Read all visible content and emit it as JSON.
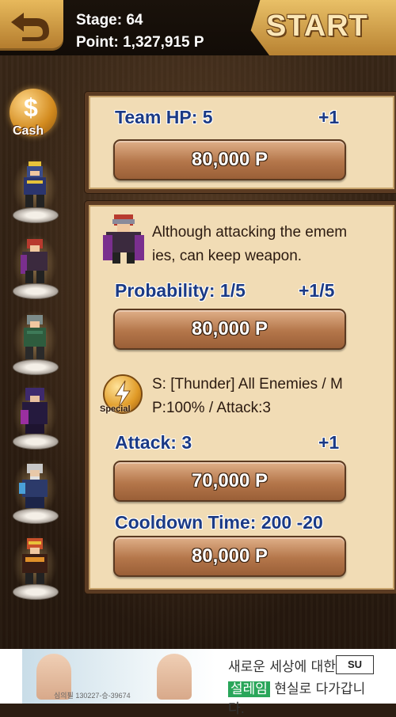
{
  "header": {
    "stage_text": "Stage: 64",
    "point_text": "Point: 1,327,915 P",
    "start_label": "START",
    "back_icon": "back-arrow-icon"
  },
  "sidebar": {
    "cash_label": "Cash",
    "cash_symbol": "$",
    "heroes": [
      "hero-1",
      "hero-2",
      "hero-3",
      "hero-4",
      "hero-5",
      "hero-6"
    ]
  },
  "team_panel": {
    "label": "Team HP: 5",
    "increment": "+1",
    "price": "80,000 P"
  },
  "skill_panel": {
    "description_line1": "Although attacking the emem",
    "description_line2": "ies, can keep weapon.",
    "probability_label": "Probability: 1/5",
    "probability_increment": "+1/5",
    "probability_price": "80,000 P",
    "special_badge": "Special",
    "special_line1": "S: [Thunder] All Enemies / M",
    "special_line2": "P:100% / Attack:3",
    "attack_label": "Attack: 3",
    "attack_increment": "+1",
    "attack_price": "70,000 P",
    "cooldown_label": "Cooldown Time: 200 -20",
    "cooldown_price": "80,000 P"
  },
  "ad": {
    "line1": "새로운 세상에 대한",
    "line2_highlight": "설레임",
    "line2_rest": " 현실로 다가갑니다.",
    "logo": "SU",
    "small_text": "심의필 130227-승-39674"
  },
  "colors": {
    "label_blue": "#1b3a85",
    "panel_bg": "#f1dcb5",
    "gold": "#e7b95c"
  }
}
